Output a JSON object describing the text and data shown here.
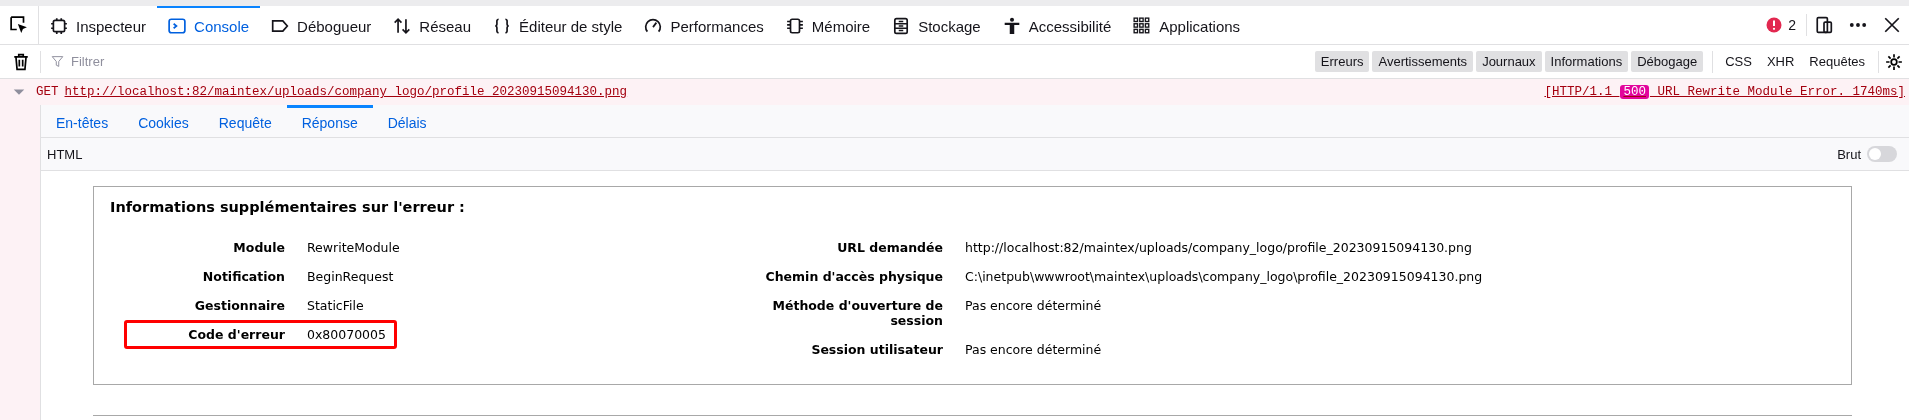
{
  "toolbar": {
    "tabs": [
      {
        "label": "Inspecteur",
        "selected": false
      },
      {
        "label": "Console",
        "selected": true
      },
      {
        "label": "Débogueur",
        "selected": false
      },
      {
        "label": "Réseau",
        "selected": false
      },
      {
        "label": "Éditeur de style",
        "selected": false
      },
      {
        "label": "Performances",
        "selected": false
      },
      {
        "label": "Mémoire",
        "selected": false
      },
      {
        "label": "Stockage",
        "selected": false
      },
      {
        "label": "Accessibilité",
        "selected": false
      },
      {
        "label": "Applications",
        "selected": false
      }
    ],
    "error_count": "2"
  },
  "filter_bar": {
    "placeholder": "Filtrer",
    "levels": [
      {
        "label": "Erreurs",
        "selected": true
      },
      {
        "label": "Avertissements",
        "selected": true
      },
      {
        "label": "Journaux",
        "selected": true
      },
      {
        "label": "Informations",
        "selected": true
      },
      {
        "label": "Débogage",
        "selected": true
      }
    ],
    "types": [
      {
        "label": "CSS",
        "selected": false
      },
      {
        "label": "XHR",
        "selected": false
      },
      {
        "label": "Requêtes",
        "selected": false
      }
    ]
  },
  "request": {
    "expanded": true,
    "method": "GET",
    "url": "http://localhost:82/maintex/uploads/company_logo/profile_20230915094130.png",
    "protocol": "[HTTP/1.1",
    "status": "500",
    "status_text": "URL Rewrite Module Error. 1740ms]",
    "tabs": [
      {
        "label": "En-têtes",
        "selected": false
      },
      {
        "label": "Cookies",
        "selected": false
      },
      {
        "label": "Requête",
        "selected": false
      },
      {
        "label": "Réponse",
        "selected": true
      },
      {
        "label": "Délais",
        "selected": false
      }
    ],
    "format": "HTML",
    "raw_label": "Brut",
    "raw_on": false
  },
  "error_details": {
    "title": "Informations supplémentaires sur l'erreur :",
    "left_rows": [
      {
        "label": "Module",
        "value": "RewriteModule",
        "highlighted": false
      },
      {
        "label": "Notification",
        "value": "BeginRequest",
        "highlighted": false
      },
      {
        "label": "Gestionnaire",
        "value": "StaticFile",
        "highlighted": false
      },
      {
        "label": "Code d'erreur",
        "value": "0x80070005",
        "highlighted": true
      }
    ],
    "right_rows": [
      {
        "label": "URL demandée",
        "value": "http://localhost:82/maintex/uploads/company_logo/profile_20230915094130.png"
      },
      {
        "label": "Chemin d'accès physique",
        "value": "C:\\inetpub\\wwwroot\\maintex\\uploads\\company_logo\\profile_20230915094130.png"
      },
      {
        "label": "Méthode d'ouverture de session",
        "value": "Pas encore déterminé"
      },
      {
        "label": "Session utilisateur",
        "value": "Pas encore déterminé"
      }
    ]
  }
}
